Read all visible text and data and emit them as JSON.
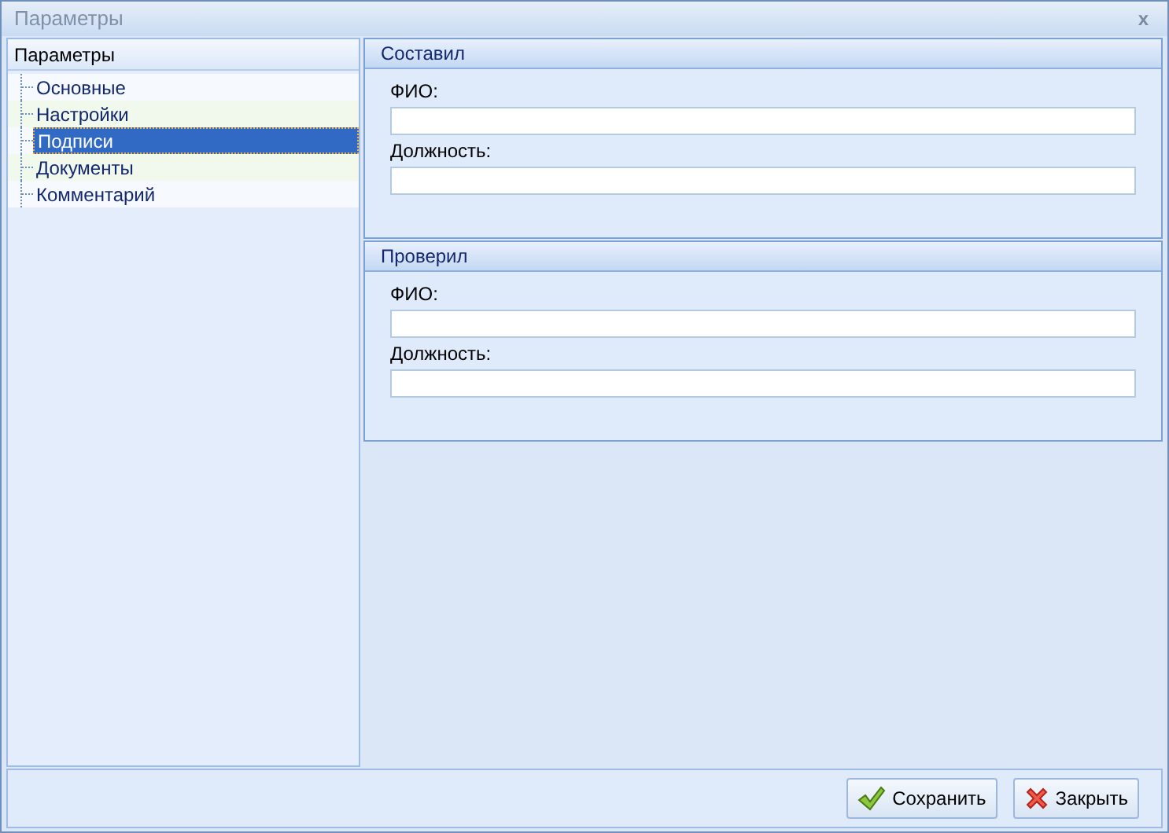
{
  "window": {
    "title": "Параметры",
    "close": "x"
  },
  "tree": {
    "header": "Параметры",
    "items": [
      {
        "label": "Основные",
        "selected": false
      },
      {
        "label": "Настройки",
        "selected": false
      },
      {
        "label": "Подписи",
        "selected": true
      },
      {
        "label": "Документы",
        "selected": false
      },
      {
        "label": "Комментарий",
        "selected": false
      }
    ]
  },
  "groups": [
    {
      "title": "Составил",
      "fields": [
        {
          "label": "ФИО:"
        },
        {
          "label": "Должность:"
        }
      ]
    },
    {
      "title": "Проверил",
      "fields": [
        {
          "label": "ФИО:"
        },
        {
          "label": "Должность:"
        }
      ]
    }
  ],
  "buttons": [
    {
      "kind": "save",
      "label": "Сохранить"
    },
    {
      "kind": "close",
      "label": "Закрыть"
    }
  ]
}
